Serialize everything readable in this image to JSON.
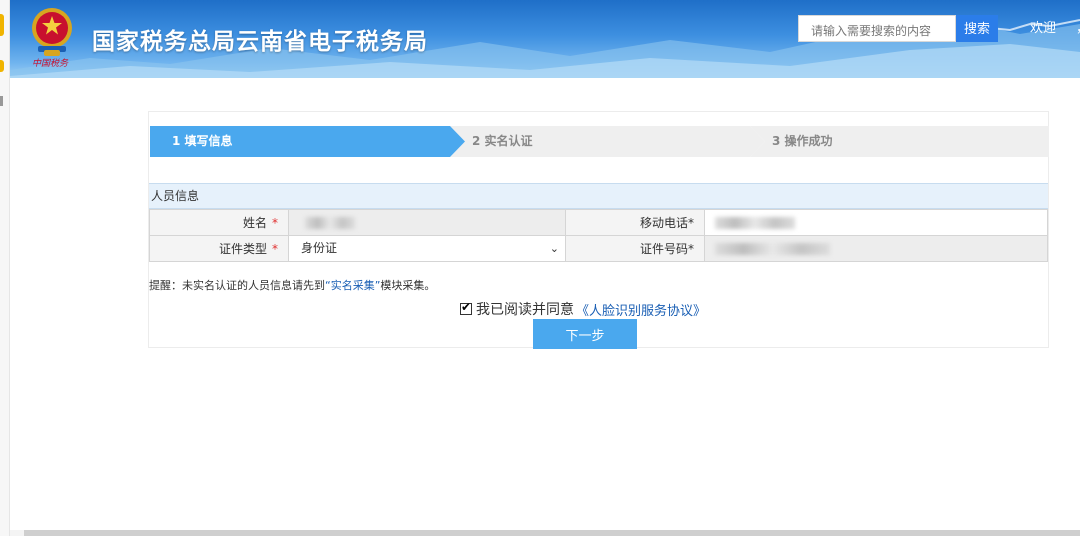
{
  "header": {
    "site_title": "国家税务总局云南省电子税务局",
    "emblem_sub": "中国税务",
    "search_placeholder": "请输入需要搜索的内容",
    "search_button": "搜索",
    "welcome": "欢迎",
    "welcome_sep": "，"
  },
  "steps": [
    {
      "label": "1  填写信息",
      "state": "active"
    },
    {
      "label": "2  实名认证",
      "state": "pending"
    },
    {
      "label": "3  操作成功",
      "state": "pending"
    }
  ],
  "form": {
    "section_title": "人员信息",
    "name_label": "姓名",
    "phone_label": "移动电话",
    "id_type_label": "证件类型",
    "id_type_value": "身份证",
    "id_number_label": "证件号码",
    "required_mark": "*"
  },
  "hint": {
    "prefix": "提醒：未实名认证的人员信息请先到",
    "link": "“实名采集”",
    "suffix": "模块采集。"
  },
  "agreement": {
    "text": "我已阅读并同意",
    "link": "《人脸识别服务协议》",
    "checked": true
  },
  "next_button": "下一步",
  "colors": {
    "accent": "#4aa8ee",
    "header_blue": "#2b7de9",
    "required": "#e03030",
    "link": "#1a5fb4"
  }
}
